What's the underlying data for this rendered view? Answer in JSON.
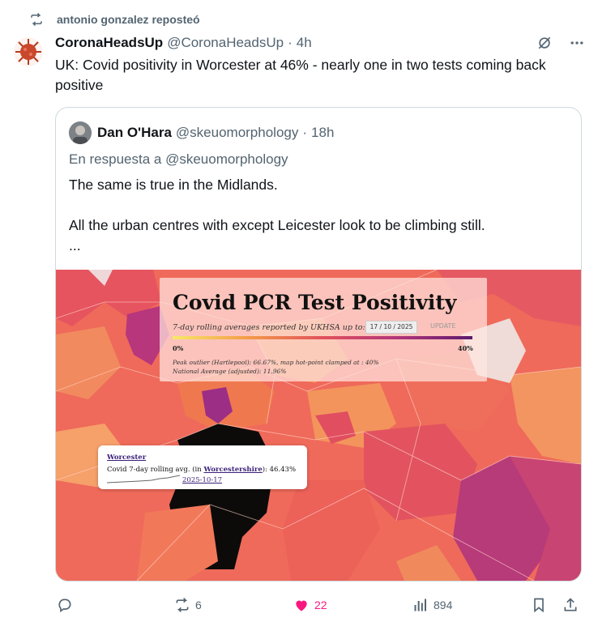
{
  "repost": {
    "label": "antonio gonzalez reposteó"
  },
  "tweet": {
    "name": "CoronaHeadsUp",
    "handle": "@CoronaHeadsUp",
    "dot": "·",
    "time": "4h",
    "text": "UK: Covid positivity in Worcester at 46% - nearly one in two tests coming back positive"
  },
  "quote": {
    "name": "Dan O'Hara",
    "handle": "@skeuomorphology",
    "dot": "·",
    "time": "18h",
    "reply_to": "En respuesta a @skeuomorphology",
    "text": "The same is true in the Midlands.\n\nAll the urban centres with except Leicester look to be climbing still.\n..."
  },
  "map": {
    "title": "Covid PCR Test Positivity",
    "subtitle": "7-day rolling averages reported by UKHSA up to:",
    "date": "17 / 10 / 2025",
    "update": "UPDATE",
    "scale_min": "0%",
    "scale_max": "40%",
    "note1": "Peak outlier (Hartlepool): 66.67%, map hot-point clamped at : 40%",
    "note2": "National Average (adjusted): 11.96%",
    "tooltip": {
      "name": "Worcester",
      "line_prefix": "Covid 7-day rolling avg. (in ",
      "county": "Worcestershire",
      "line_suffix": "): 46.43%",
      "date": "2025-10-17"
    }
  },
  "actions": {
    "reposts": "6",
    "likes": "22",
    "views": "894"
  },
  "colors": {
    "accent_like": "#f91880",
    "muted": "#536471",
    "border": "#cfd9de"
  }
}
